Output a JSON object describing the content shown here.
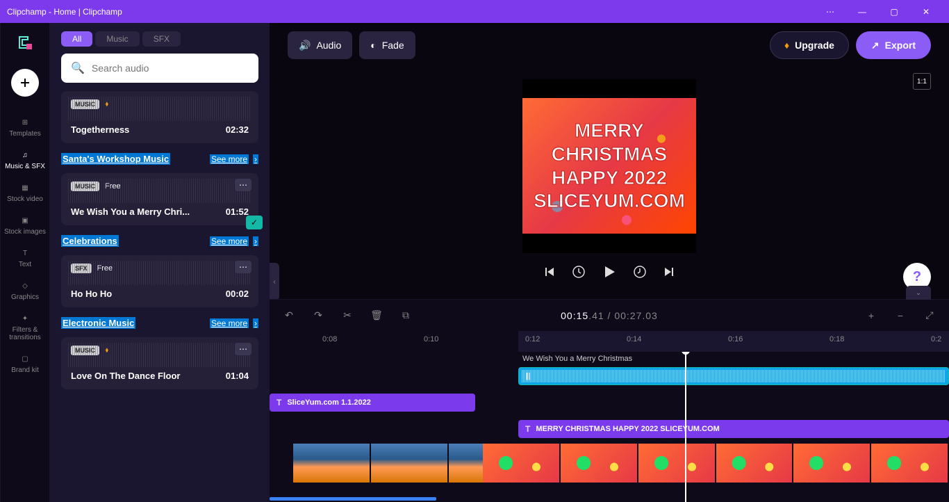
{
  "window": {
    "title": "Clipchamp - Home | Clipchamp"
  },
  "rail": {
    "add": "+",
    "items": [
      {
        "icon": "templates",
        "label": "Templates"
      },
      {
        "icon": "music",
        "label": "Music & SFX",
        "active": true
      },
      {
        "icon": "stockvideo",
        "label": "Stock video"
      },
      {
        "icon": "stockimg",
        "label": "Stock images"
      },
      {
        "icon": "text",
        "label": "Text"
      },
      {
        "icon": "graphics",
        "label": "Graphics"
      },
      {
        "icon": "fx",
        "label": "Filters & transitions"
      },
      {
        "icon": "brand",
        "label": "Brand kit"
      }
    ]
  },
  "panel": {
    "tabs": {
      "all": "All",
      "music": "Music",
      "sfx": "SFX"
    },
    "search_placeholder": "Search audio",
    "see_more": "See more",
    "sections": {
      "s1": {
        "title": "Santa's Workshop Music"
      },
      "s2": {
        "title": "Celebrations"
      },
      "s3": {
        "title": "Electronic Music"
      }
    },
    "cards": {
      "togetherness": {
        "badge": "MUSIC",
        "premium": true,
        "title": "Togetherness",
        "dur": "02:32"
      },
      "wewish": {
        "badge": "MUSIC",
        "free": "Free",
        "title": "We Wish You a Merry Chri...",
        "dur": "01:52",
        "checked": true
      },
      "hohoho": {
        "badge": "SFX",
        "free": "Free",
        "title": "Ho Ho Ho",
        "dur": "00:02"
      },
      "love": {
        "badge": "MUSIC",
        "premium": true,
        "title": "Love On The Dance Floor",
        "dur": "01:04"
      }
    }
  },
  "topbar": {
    "audio": "Audio",
    "fade": "Fade",
    "upgrade": "Upgrade",
    "export": "Export"
  },
  "preview": {
    "aspect": "1:1",
    "text": "MERRY CHRISTMAS HAPPY 2022 SLICEYUM.COM"
  },
  "timeline": {
    "time_cur": "00:15",
    "time_cur_ms": ".41",
    "time_tot": "00:27",
    "time_tot_ms": ".03",
    "ticks": {
      "t1": "0:08",
      "t2": "0:10",
      "t3": "0:12",
      "t4": "0:14",
      "t5": "0:16",
      "t6": "0:18",
      "t7": "0:2"
    },
    "audio_label": "We Wish You a Merry Christmas",
    "clip1": "SliceYum.com 1.1.2022",
    "clip2": "MERRY CHRISTMAS HAPPY 2022 SLICEYUM.COM"
  }
}
